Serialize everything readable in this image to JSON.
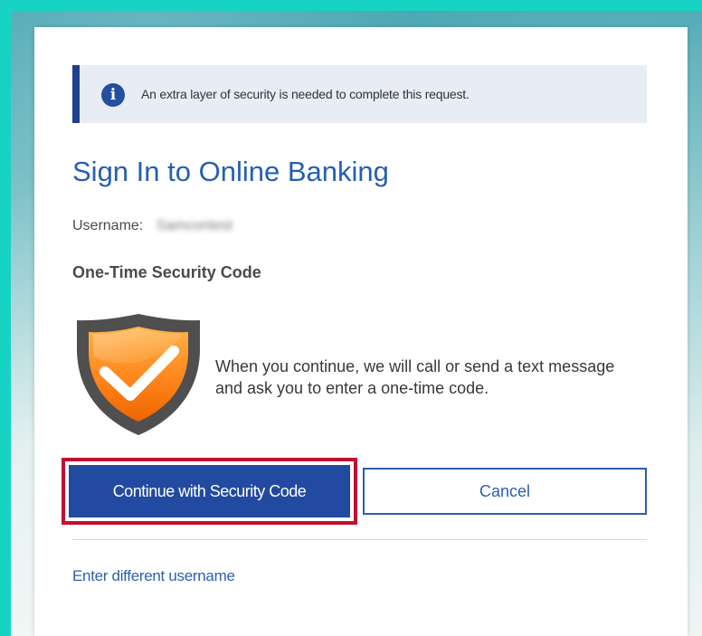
{
  "banner": {
    "icon": "info-icon",
    "text": "An extra layer of security is needed to complete this request.",
    "accent_color": "#1e3f8f"
  },
  "page": {
    "title": "Sign In to Online Banking",
    "username_label": "Username:",
    "username_value": "Samcontest",
    "section_title": "One-Time Security Code",
    "shield_icon": "shield-check-icon",
    "instructions": "When you continue, we will call or send a text message and ask you to enter a one-time code."
  },
  "actions": {
    "continue_label": "Continue with Security Code",
    "cancel_label": "Cancel",
    "different_username_link": "Enter different username",
    "primary_color": "#214aa0",
    "highlight_color": "#c0112f"
  }
}
